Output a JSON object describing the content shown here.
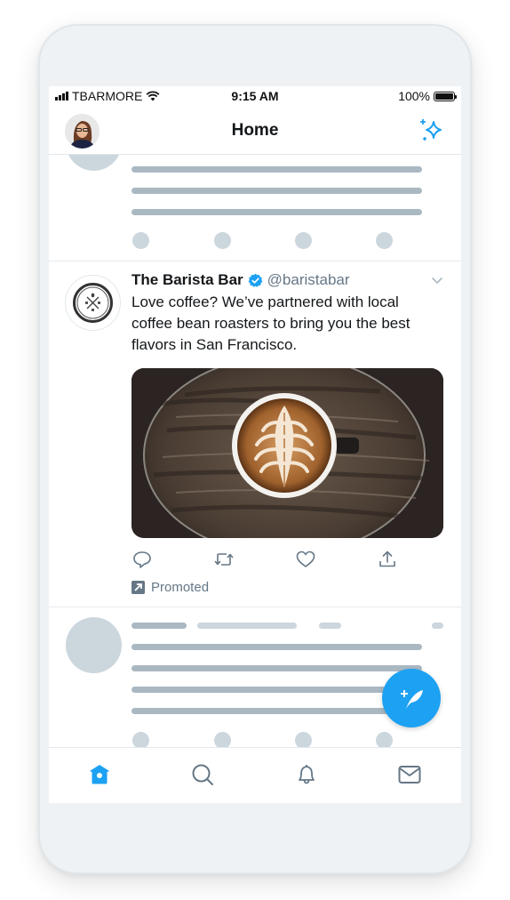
{
  "status_bar": {
    "carrier": "TBARMORE",
    "time": "9:15 AM",
    "battery": "100%"
  },
  "header": {
    "title": "Home",
    "avatar_icon": "user-avatar",
    "right_icon": "sparkle-icon"
  },
  "feed": {
    "placeholder_top": {
      "type": "loading-skeleton"
    },
    "promoted_tweet": {
      "display_name": "The Barista Bar",
      "verified": true,
      "handle": "@baristabar",
      "text": "Love coffee? We’ve partnered with local coffee bean roasters to bring you the best flavors in San Francisco.",
      "media": "latte-art-photo",
      "actions": [
        {
          "name": "reply",
          "icon": "reply-icon"
        },
        {
          "name": "retweet",
          "icon": "retweet-icon"
        },
        {
          "name": "like",
          "icon": "heart-icon"
        },
        {
          "name": "share",
          "icon": "share-icon"
        }
      ],
      "promoted_label": "Promoted"
    },
    "placeholder_bottom": {
      "type": "loading-skeleton"
    }
  },
  "compose_button": {
    "icon": "compose-tweet-icon"
  },
  "tab_bar": {
    "tabs": [
      {
        "name": "home",
        "icon": "home-icon",
        "active": true
      },
      {
        "name": "search",
        "icon": "search-icon",
        "active": false
      },
      {
        "name": "notifications",
        "icon": "bell-icon",
        "active": false
      },
      {
        "name": "messages",
        "icon": "mail-icon",
        "active": false
      }
    ]
  },
  "colors": {
    "accent": "#1da1f2",
    "text_primary": "#14171a",
    "text_secondary": "#657786",
    "skeleton_dark": "#aab8c2",
    "skeleton_light": "#ccd6dd",
    "frame_bg": "#eff2f5"
  }
}
